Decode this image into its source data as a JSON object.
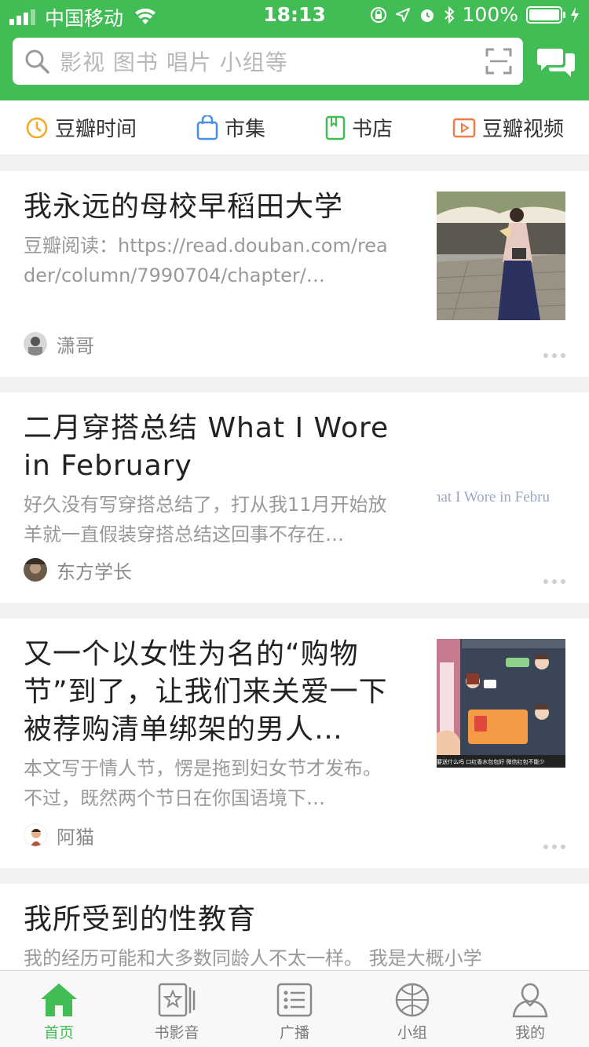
{
  "status_bar": {
    "carrier": "中国移动",
    "time": "18:13",
    "battery": "100%"
  },
  "search": {
    "placeholder": "影视 图书 唱片 小组等"
  },
  "shortcuts": [
    {
      "label": "豆瓣时间",
      "icon": "clock-icon",
      "color": "#f5a623"
    },
    {
      "label": "市集",
      "icon": "bag-icon",
      "color": "#4a90e2"
    },
    {
      "label": "书店",
      "icon": "book-icon",
      "color": "#42bd56"
    },
    {
      "label": "豆瓣视频",
      "icon": "play-icon",
      "color": "#f07c4a"
    }
  ],
  "feed": [
    {
      "title": "我永远的母校早稻田大学",
      "desc": "豆瓣阅读：https://read.douban.com/reader/column/7990704/chapter/…",
      "author": "潇哥",
      "thumbnail": "photo of woman in kimono on plaza"
    },
    {
      "title": "二月穿搭总结 What I Wore in February",
      "desc": "好久没有写穿搭总结了，打从我11月开始放羊就一直假装穿搭总结这回事不存在…",
      "author": "东方学长",
      "thumb_text": "hat I Wore in Febru"
    },
    {
      "title": "又一个以女性为名的“购物节”到了，让我们来关爱一下被荐购清单绑架的男人…",
      "desc": "本文写于情人节，愣是拖到妇女节才发布。不过，既然两个节日在你国语境下…",
      "author": "阿猫",
      "thumb_caption": "要送什么吗  口红香水包包好  微信红包不能少"
    },
    {
      "title": "我所受到的性教育",
      "desc": "我的经历可能和大多数同龄人不太一样。 我是大概小学"
    }
  ],
  "tabbar": [
    {
      "label": "首页",
      "icon": "home-icon",
      "active": true
    },
    {
      "label": "书影音",
      "icon": "media-icon",
      "active": false
    },
    {
      "label": "广播",
      "icon": "broadcast-icon",
      "active": false
    },
    {
      "label": "小组",
      "icon": "group-icon",
      "active": false
    },
    {
      "label": "我的",
      "icon": "profile-icon",
      "active": false
    }
  ]
}
